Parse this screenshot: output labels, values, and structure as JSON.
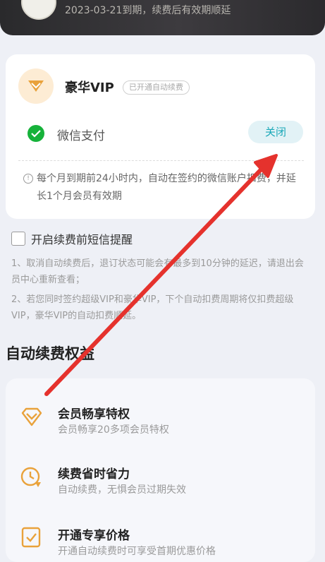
{
  "header": {
    "expire_text": "2023-03-21到期，续费后有效期顺延"
  },
  "subscription": {
    "title": "豪华VIP",
    "badge": "已开通自动续费",
    "payment_method": "微信支付",
    "close_label": "关闭",
    "info": "每个月到期前24小时内，自动在签约的微信账户扣费，并延长1个月会员有效期"
  },
  "sms_reminder": {
    "label": "开启续费前短信提醒",
    "checked": false
  },
  "notes": [
    "1、取消自动续费后，退订状态可能会有最多到10分钟的延迟，请退出会员中心重新查看；",
    "2、若您同时签约超级VIP和豪华VIP，下个自动扣费周期将仅扣费超级VIP，豪华VIP的自动扣费顺延。"
  ],
  "benefits_section": {
    "title": "自动续费权益",
    "items": [
      {
        "icon": "diamond-icon",
        "title": "会员畅享特权",
        "desc": "会员畅享20多项会员特权"
      },
      {
        "icon": "clock-icon",
        "title": "续费省时省力",
        "desc": "自动续费，无惧会员过期失效"
      },
      {
        "icon": "check-tag-icon",
        "title": "开通专享价格",
        "desc": "开通自动续费时可享受首期优惠价格"
      }
    ]
  },
  "colors": {
    "accent": "#1aa8b8",
    "wechat_green": "#16b23a",
    "vip_gold": "#e9a23b",
    "annotation_red": "#e5322d"
  }
}
